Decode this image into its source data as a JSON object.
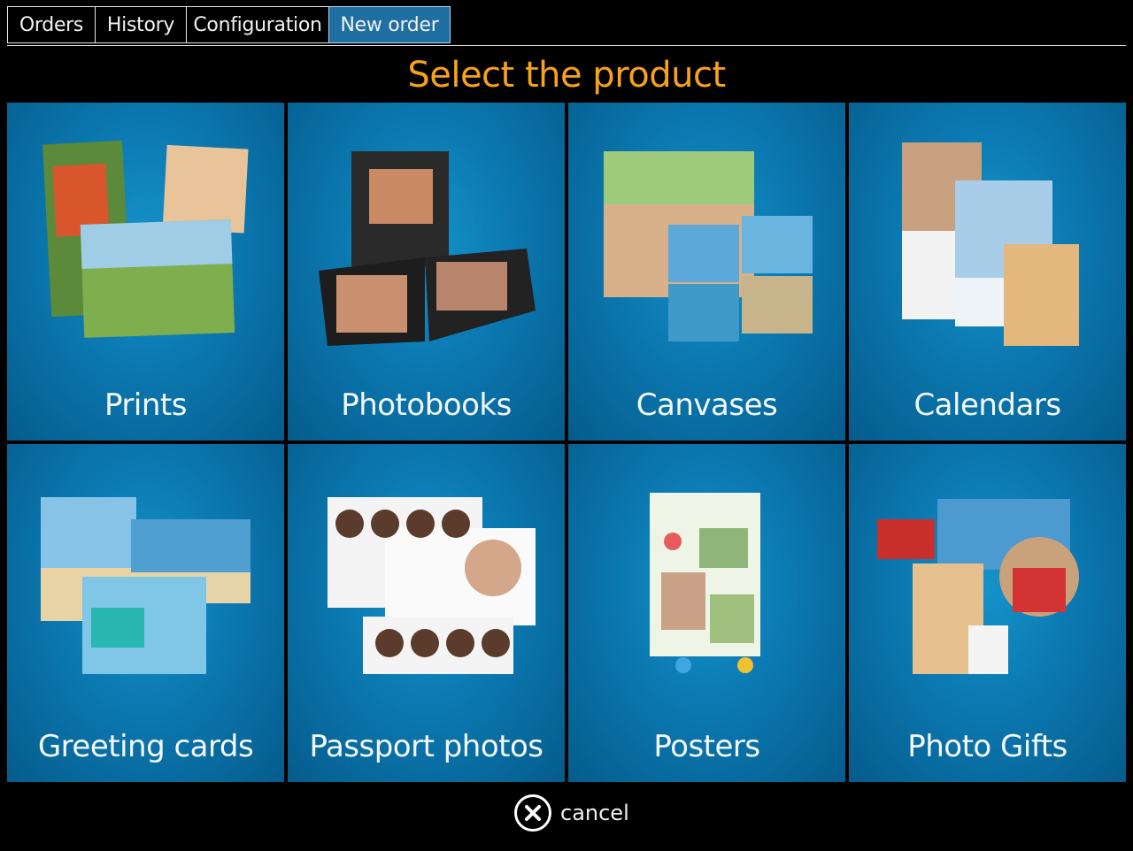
{
  "tabs": {
    "orders": "Orders",
    "history": "History",
    "configuration": "Configuration",
    "new_order": "New order"
  },
  "title": "Select the product",
  "products": {
    "prints": "Prints",
    "photobooks": "Photobooks",
    "canvases": "Canvases",
    "calendars": "Calendars",
    "greeting_cards": "Greeting cards",
    "passport_photos": "Passport photos",
    "posters": "Posters",
    "photo_gifts": "Photo Gifts"
  },
  "cancel": "cancel",
  "colors": {
    "accent": "#f7a21b",
    "active_tab": "#1f6fa3",
    "tile": "#0b78b0"
  }
}
